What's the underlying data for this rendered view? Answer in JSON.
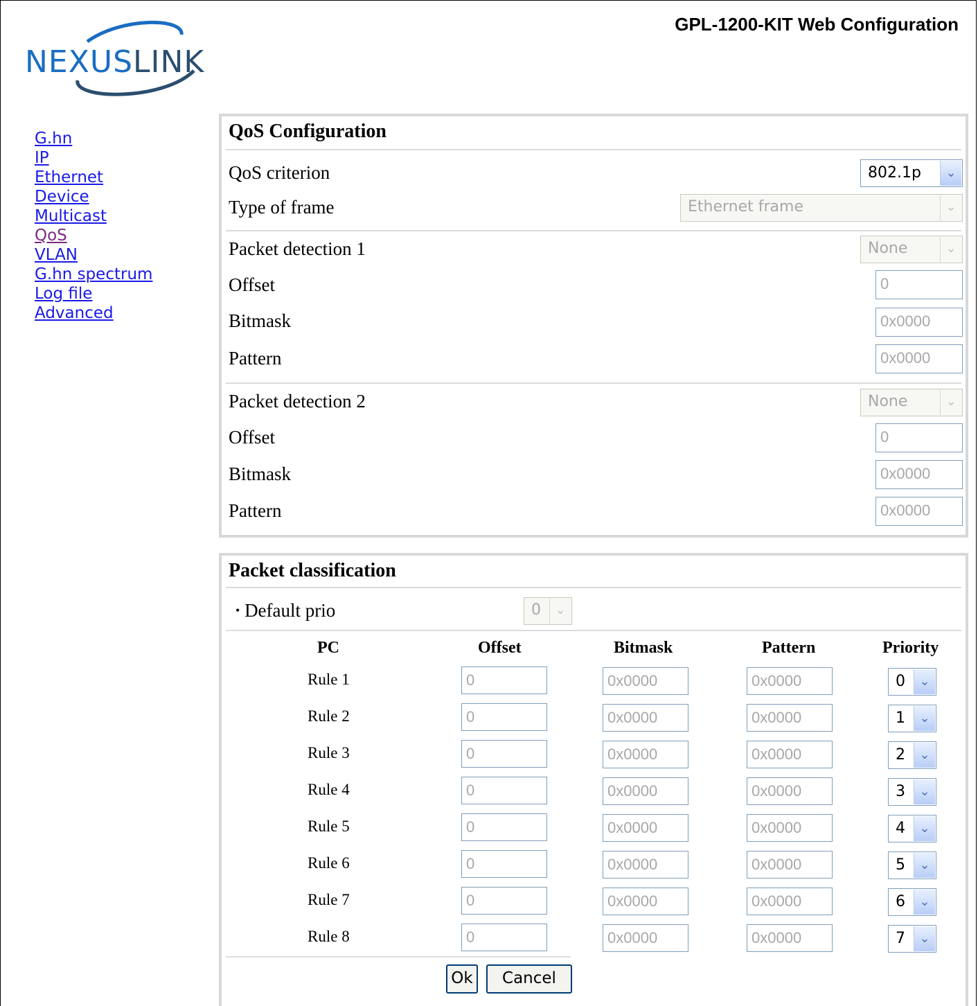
{
  "header": {
    "app_title": "GPL-1200-KIT Web Configuration",
    "logo_text_part1": "NEXUS",
    "logo_text_part2": "LINK"
  },
  "nav": {
    "items": [
      {
        "label": "G.hn",
        "visited": false
      },
      {
        "label": "IP",
        "visited": false
      },
      {
        "label": "Ethernet",
        "visited": false
      },
      {
        "label": "Device",
        "visited": false
      },
      {
        "label": "Multicast",
        "visited": false
      },
      {
        "label": "QoS",
        "visited": true
      },
      {
        "label": "VLAN",
        "visited": false
      },
      {
        "label": "G.hn spectrum",
        "visited": false
      },
      {
        "label": "Log file",
        "visited": false
      },
      {
        "label": "Advanced",
        "visited": false
      }
    ]
  },
  "qos": {
    "title": "QoS Configuration",
    "criterion_label": "QoS criterion",
    "criterion_value": "802.1p",
    "frame_label": "Type of frame",
    "frame_value": "Ethernet frame",
    "pd1": {
      "label": "Packet detection 1",
      "value": "None",
      "offset_label": "Offset",
      "offset": "0",
      "bitmask_label": "Bitmask",
      "bitmask": "0x0000",
      "pattern_label": "Pattern",
      "pattern": "0x0000"
    },
    "pd2": {
      "label": "Packet detection 2",
      "value": "None",
      "offset_label": "Offset",
      "offset": "0",
      "bitmask_label": "Bitmask",
      "bitmask": "0x0000",
      "pattern_label": "Pattern",
      "pattern": "0x0000"
    }
  },
  "classification": {
    "title": "Packet classification",
    "default_prio_label": "Default prio",
    "default_prio_value": "0",
    "columns": {
      "pc": "PC",
      "offset": "Offset",
      "bitmask": "Bitmask",
      "pattern": "Pattern",
      "priority": "Priority"
    },
    "rules": [
      {
        "label": "Rule 1",
        "offset": "0",
        "bitmask": "0x0000",
        "pattern": "0x0000",
        "priority": "0"
      },
      {
        "label": "Rule 2",
        "offset": "0",
        "bitmask": "0x0000",
        "pattern": "0x0000",
        "priority": "1"
      },
      {
        "label": "Rule 3",
        "offset": "0",
        "bitmask": "0x0000",
        "pattern": "0x0000",
        "priority": "2"
      },
      {
        "label": "Rule 4",
        "offset": "0",
        "bitmask": "0x0000",
        "pattern": "0x0000",
        "priority": "3"
      },
      {
        "label": "Rule 5",
        "offset": "0",
        "bitmask": "0x0000",
        "pattern": "0x0000",
        "priority": "4"
      },
      {
        "label": "Rule 6",
        "offset": "0",
        "bitmask": "0x0000",
        "pattern": "0x0000",
        "priority": "5"
      },
      {
        "label": "Rule 7",
        "offset": "0",
        "bitmask": "0x0000",
        "pattern": "0x0000",
        "priority": "6"
      },
      {
        "label": "Rule 8",
        "offset": "0",
        "bitmask": "0x0000",
        "pattern": "0x0000",
        "priority": "7"
      }
    ],
    "ok_label": "Ok",
    "cancel_label": "Cancel"
  }
}
